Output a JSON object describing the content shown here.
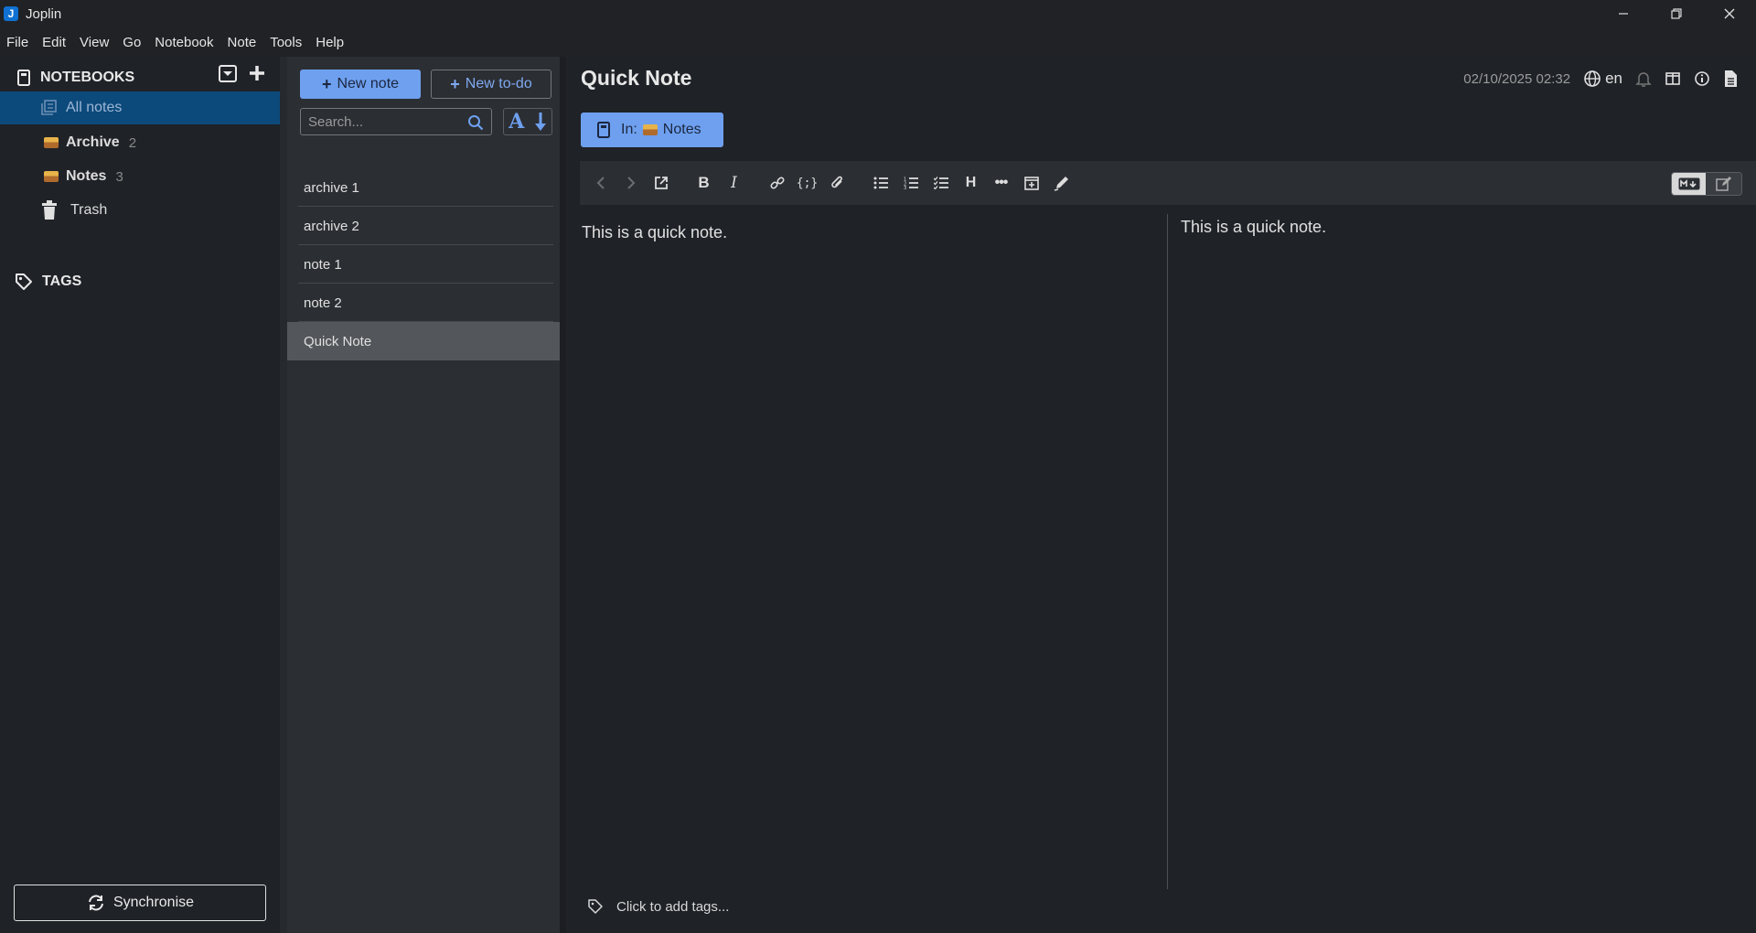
{
  "window": {
    "title": "Joplin",
    "logo_letter": "J"
  },
  "menu": [
    "File",
    "Edit",
    "View",
    "Go",
    "Notebook",
    "Note",
    "Tools",
    "Help"
  ],
  "sidebar": {
    "notebooks_label": "NOTEBOOKS",
    "all_notes": "All notes",
    "items": [
      {
        "label": "Archive",
        "count": "2"
      },
      {
        "label": "Notes",
        "count": "3"
      }
    ],
    "trash": "Trash",
    "tags_label": "TAGS",
    "sync_label": "Synchronise"
  },
  "notelist": {
    "new_note": "New note",
    "new_todo": "New to-do",
    "search_placeholder": "Search...",
    "sort_letter": "A",
    "notes": [
      "archive 1",
      "archive 2",
      "note 1",
      "note 2",
      "Quick Note"
    ],
    "selected": "Quick Note"
  },
  "editor": {
    "title": "Quick Note",
    "date": "02/10/2025 02:32",
    "language": "en",
    "notebook_prefix": "In:",
    "notebook_name": "Notes",
    "body": "This is a quick note.",
    "preview": "This is a quick note.",
    "tags_placeholder": "Click to add tags..."
  },
  "colors": {
    "accent": "#6ea0ef",
    "selected_sidebar": "#0c4a7b",
    "bg": "#1f2227",
    "list_bg": "#2b2e33"
  }
}
